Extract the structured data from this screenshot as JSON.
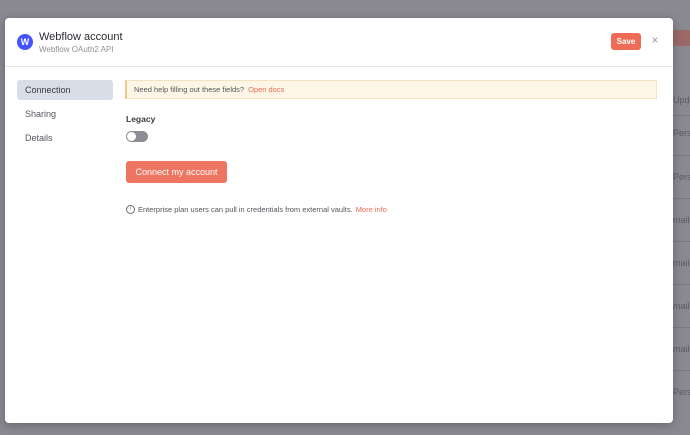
{
  "background": {
    "right_labels": [
      "Update",
      "Person",
      "Person",
      "mail",
      "mail",
      "mail",
      "mail",
      "Person"
    ]
  },
  "modal": {
    "title": "Webflow account",
    "subtitle": "Webflow OAuth2 API",
    "logo_letter": "W",
    "save_label": "Save",
    "close_icon": "×"
  },
  "sidebar": {
    "items": [
      {
        "label": "Connection",
        "active": true
      },
      {
        "label": "Sharing",
        "active": false
      },
      {
        "label": "Details",
        "active": false
      }
    ]
  },
  "main": {
    "help_text": "Need help filling out these fields?",
    "help_link": "Open docs",
    "legacy_label": "Legacy",
    "legacy_enabled": false,
    "connect_label": "Connect my account",
    "info_icon": "i",
    "info_text": "Enterprise plan users can pull in credentials from external vaults.",
    "info_link": "More info"
  },
  "colors": {
    "accent": "#ee6c55",
    "brand": "#4353ff"
  }
}
